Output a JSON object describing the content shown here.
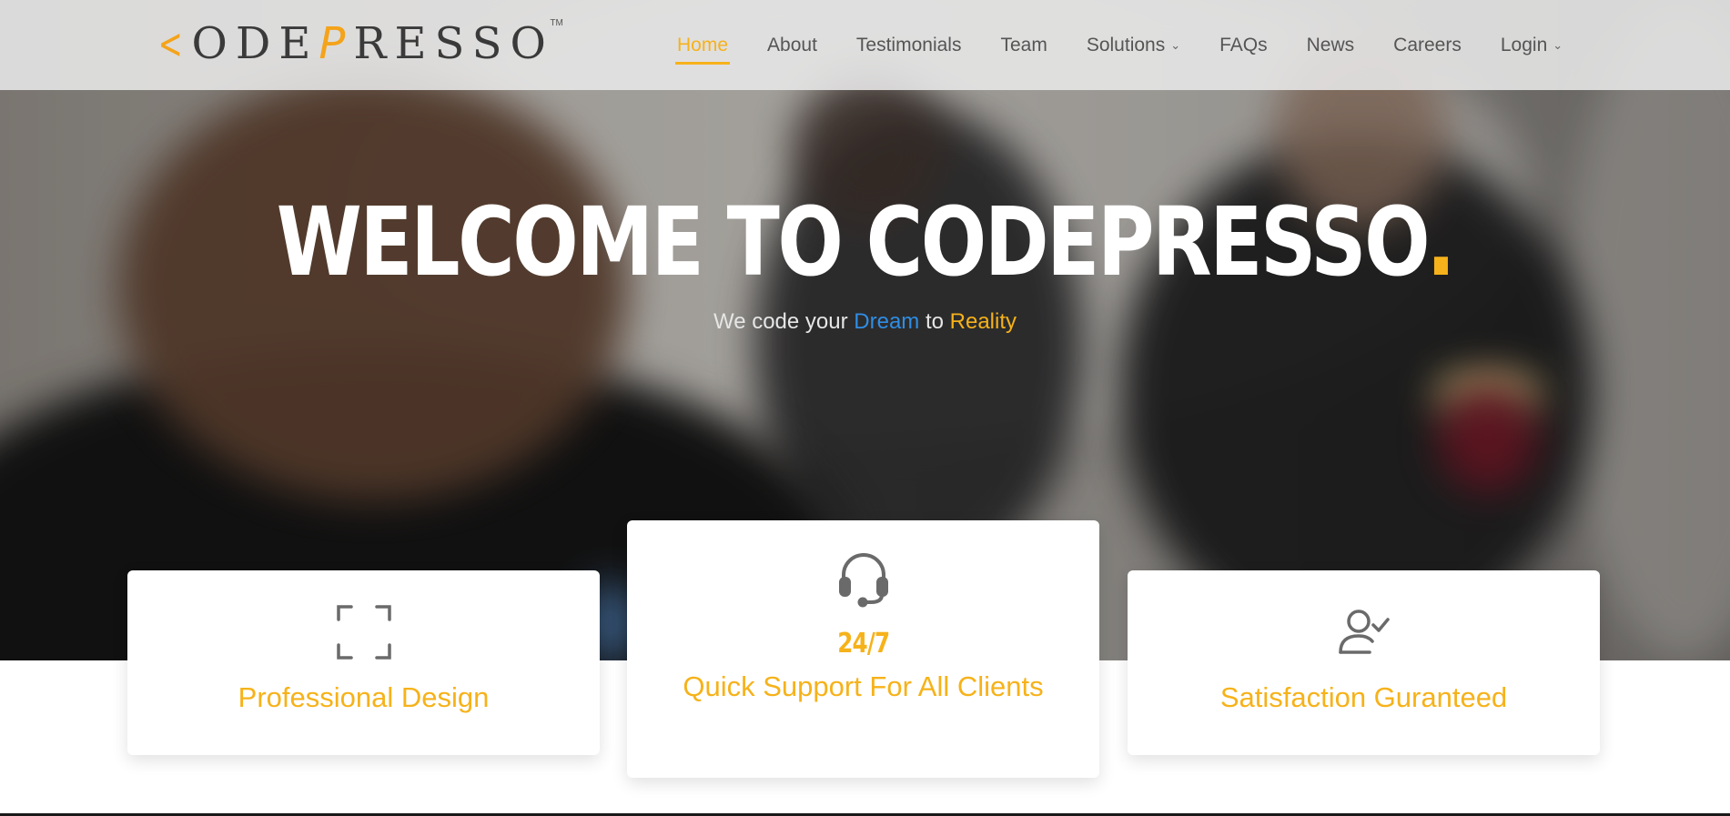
{
  "brand": {
    "logo_text": "CODEPRESSO",
    "logo_prefix": "<",
    "logo_before": "ODE",
    "logo_accent": "P",
    "logo_after": "RESSO",
    "trademark": "TM"
  },
  "nav": {
    "items": [
      {
        "label": "Home",
        "active": true
      },
      {
        "label": "About"
      },
      {
        "label": "Testimonials"
      },
      {
        "label": "Team"
      },
      {
        "label": "Solutions",
        "has_dropdown": true
      },
      {
        "label": "FAQs"
      },
      {
        "label": "News"
      },
      {
        "label": "Careers"
      },
      {
        "label": "Login",
        "has_dropdown": true
      }
    ],
    "caret_icon": "chevron-down-icon"
  },
  "hero": {
    "title": "WELCOME TO CODEPRESSO",
    "title_dot": ".",
    "subtitle_part1": "We code your",
    "subtitle_dream": "Dream",
    "subtitle_part2": "to",
    "subtitle_reality": "Reality"
  },
  "features": [
    {
      "icon": "expand-frame-icon",
      "stat": "",
      "title": "Professional Design"
    },
    {
      "icon": "headset-icon",
      "stat": "24/7",
      "title": "Quick Support For All Clients"
    },
    {
      "icon": "user-check-icon",
      "stat": "",
      "title": "Satisfaction Guranteed"
    }
  ],
  "colors": {
    "accent": "#f6b21a",
    "dream": "#2f8de4",
    "nav_text": "#555555",
    "header_bg": "#e8e8e8"
  }
}
